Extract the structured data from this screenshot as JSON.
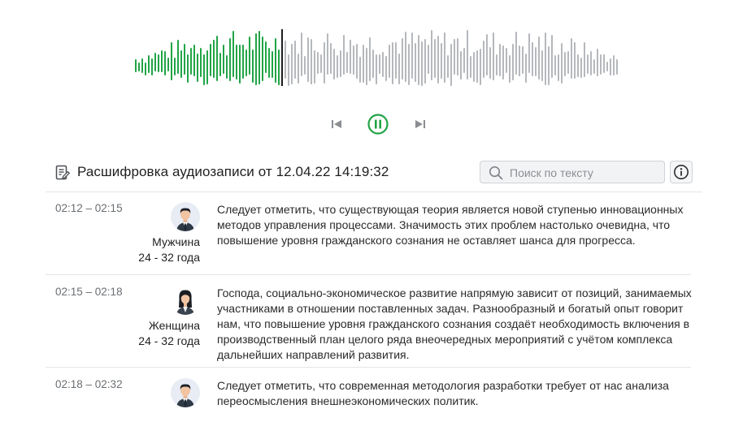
{
  "colors": {
    "played": "#22a447",
    "unplayed": "#b5b8bc",
    "playhead": "#1d1d1d",
    "accent": "#22a447"
  },
  "player": {
    "progress": 0.3,
    "controls": {
      "prev_icon": "skip-back-icon",
      "play_icon": "pause-circle-icon",
      "next_icon": "skip-forward-icon"
    }
  },
  "transcript": {
    "title": "Расшифровка аудиозаписи от 12.04.22 14:19:32",
    "title_icon": "document-edit-icon",
    "search": {
      "placeholder": "Поиск по тексту",
      "value": "",
      "icon": "search-icon"
    },
    "info_icon": "info-icon",
    "entries": [
      {
        "time": "02:12 – 02:15",
        "speaker": "Мужчина",
        "age": "24 - 32 года",
        "avatar": "man-avatar",
        "text": "Следует отметить, что существующая теория является новой ступенью инновационных методов управления процессами. Значимость этих проблем настолько очевидна, что повышение уровня гражданского сознания не оставляет шанса для прогресса."
      },
      {
        "time": "02:15 – 02:18",
        "speaker": "Женщина",
        "age": "24 - 32 года",
        "avatar": "woman-avatar",
        "text": "Господа, социально-экономическое развитие напрямую зависит от позиций, занимаемых участниками в отношении поставленных задач. Разнообразный и богатый опыт говорит нам, что повышение уровня гражданского сознания создаёт необходимость включения в производственный план целого ряда внеочередных мероприятий с учётом комплекса дальнейших направлений развития."
      },
      {
        "time": "02:18 – 02:32",
        "speaker": "",
        "age": "",
        "avatar": "man-avatar",
        "text": "Следует отметить, что современная методология разработки требует от нас анализа переосмысления внешнеэкономических политик."
      }
    ]
  }
}
